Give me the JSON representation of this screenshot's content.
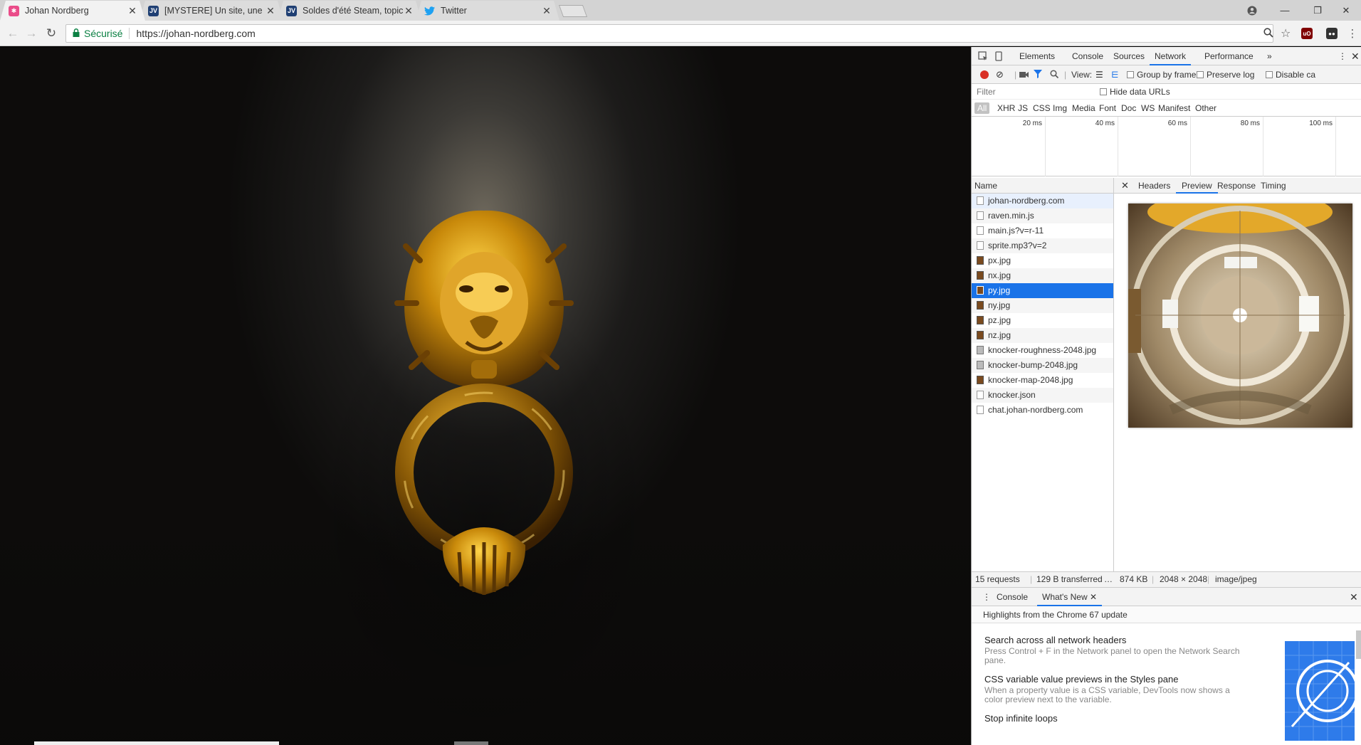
{
  "browser": {
    "tabs": [
      {
        "title": "Johan Nordberg",
        "favicon": "dribbble-pink-icon",
        "active": true
      },
      {
        "title": "[MYSTERE] Un site, une p",
        "favicon": "jvc-icon",
        "active": false
      },
      {
        "title": "Soldes d'été Steam, topic",
        "favicon": "jvc-icon",
        "active": false
      },
      {
        "title": "Twitter",
        "favicon": "twitter-icon",
        "active": false
      }
    ],
    "security_label": "Sécurisé",
    "url": "https://johan-nordberg.com"
  },
  "devtools": {
    "panels": [
      "Elements",
      "Console",
      "Sources",
      "Network",
      "Performance"
    ],
    "active_panel": "Network",
    "toolbar": {
      "view_label": "View:",
      "group_by_frame": "Group by frame",
      "preserve_log": "Preserve log",
      "disable_cache": "Disable ca"
    },
    "filter_placeholder": "Filter",
    "hide_data_urls": "Hide data URLs",
    "types": [
      "All",
      "XHR",
      "JS",
      "CSS",
      "Img",
      "Media",
      "Font",
      "Doc",
      "WS",
      "Manifest",
      "Other"
    ],
    "timeline_ticks": [
      "20 ms",
      "40 ms",
      "60 ms",
      "80 ms",
      "100 ms"
    ],
    "name_header": "Name",
    "requests": [
      {
        "name": "johan-nordberg.com",
        "kind": "doc"
      },
      {
        "name": "raven.min.js",
        "kind": "doc"
      },
      {
        "name": "main.js?v=r-11",
        "kind": "doc"
      },
      {
        "name": "sprite.mp3?v=2",
        "kind": "doc"
      },
      {
        "name": "px.jpg",
        "kind": "img"
      },
      {
        "name": "nx.jpg",
        "kind": "img"
      },
      {
        "name": "py.jpg",
        "kind": "img"
      },
      {
        "name": "ny.jpg",
        "kind": "img"
      },
      {
        "name": "pz.jpg",
        "kind": "img"
      },
      {
        "name": "nz.jpg",
        "kind": "img"
      },
      {
        "name": "knocker-roughness-2048.jpg",
        "kind": "img2"
      },
      {
        "name": "knocker-bump-2048.jpg",
        "kind": "img2"
      },
      {
        "name": "knocker-map-2048.jpg",
        "kind": "img"
      },
      {
        "name": "knocker.json",
        "kind": "doc"
      },
      {
        "name": "chat.johan-nordberg.com",
        "kind": "doc"
      }
    ],
    "selected_request": "py.jpg",
    "detail_tabs": [
      "Headers",
      "Preview",
      "Response",
      "Timing"
    ],
    "active_detail_tab": "Preview",
    "status": {
      "requests": "15 requests",
      "transferred": "129 B transferred",
      "more": "…",
      "size": "874 KB",
      "dimensions": "2048 × 2048",
      "mime": "image/jpeg"
    },
    "drawer": {
      "tabs": [
        "Console",
        "What's New"
      ],
      "active_tab": "What's New",
      "subtitle": "Highlights from the Chrome 67 update",
      "items": [
        {
          "title": "Search across all network headers",
          "body": "Press Control + F in the Network panel to open the Network Search pane."
        },
        {
          "title": "CSS variable value previews in the Styles pane",
          "body": "When a property value is a CSS variable, DevTools now shows a color preview next to the variable."
        },
        {
          "title": "Stop infinite loops",
          "body": ""
        }
      ]
    }
  },
  "colors": {
    "accent": "#1a73e8",
    "secure": "#0b8043",
    "record": "#d93025"
  }
}
